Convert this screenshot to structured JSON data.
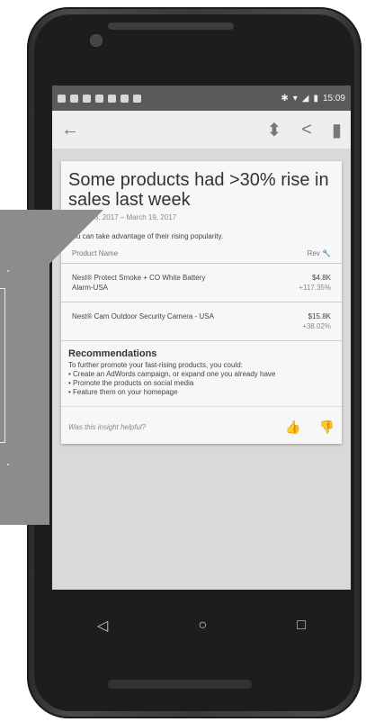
{
  "status_bar": {
    "time": "15:09"
  },
  "app_bar": {
    "back_icon": "arrow-left-icon",
    "actions": [
      "pin-icon",
      "share-icon",
      "trash-icon"
    ]
  },
  "insight": {
    "title": "Some products had >30% rise in sales last week",
    "date_range": "March 13, 2017 – March 19, 2017",
    "intro": "You can take advantage of their rising popularity.",
    "table": {
      "col_product": "Product Name",
      "col_revenue": "Rev",
      "rows": [
        {
          "name": "Nest® Protect Smoke + CO White Battery Alarm-USA",
          "value": "$4.8K",
          "change": "+117.35%"
        },
        {
          "name": "Nest® Cam Outdoor Security Camera - USA",
          "value": "$15.8K",
          "change": "+38.02%"
        }
      ]
    },
    "recommendations_title": "Recommendations",
    "recommendations_intro": "To further promote your fast-rising products, you could:",
    "recommendations": [
      "Create an AdWords campaign, or expand one you already have",
      "Promote the products on social media",
      "Feature them on your homepage"
    ],
    "feedback_question": "Was this insight helpful?"
  },
  "nav": [
    "back-icon",
    "home-icon",
    "recents-icon"
  ]
}
